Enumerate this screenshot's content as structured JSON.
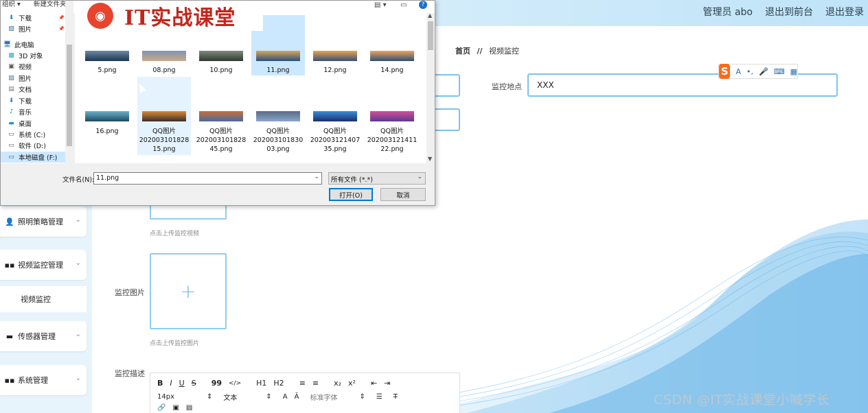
{
  "header": {
    "admin": "管理员 abo",
    "to_front": "退出到前台",
    "logout": "退出登录"
  },
  "breadcrumb": {
    "home": "首页",
    "sep": "//",
    "current": "视频监控"
  },
  "form": {
    "location_label": "监控地点",
    "location_value": "XXX",
    "video_hint": "点击上传监控视频",
    "image_label": "监控图片",
    "image_hint": "点击上传监控图片",
    "desc_label": "监控描述"
  },
  "sidebar": {
    "items": [
      {
        "label": "照明策略管理",
        "icon": "user-icon"
      },
      {
        "label": "视频监控管理",
        "icon": "grid-icon"
      },
      {
        "label": "视频监控",
        "sub": true
      },
      {
        "label": "传感器管理",
        "icon": "monitor-icon"
      },
      {
        "label": "系统管理",
        "icon": "grid-icon"
      }
    ]
  },
  "editor": {
    "toolbar1": [
      "B",
      "I",
      "U",
      "S",
      "99",
      "</>",
      "H1",
      "H2",
      "≡",
      "≡",
      "x₂",
      "x²",
      "⇤",
      "⇥"
    ],
    "font_size": "14px",
    "block_type": "文本",
    "font_family": "标准字体"
  },
  "ime": {
    "logo": "S"
  },
  "watermark": "CSDN @IT实战课堂小喊学长",
  "dialog": {
    "toolbar_left": "组织 ▾",
    "new_folder": "新建文件夹",
    "banner_text": "IT实战课堂",
    "nav": [
      {
        "label": "下载",
        "icon": "download-icon",
        "pinned": true
      },
      {
        "label": "图片",
        "icon": "picture-icon",
        "pinned": true
      },
      {
        "label": "此电脑",
        "icon": "computer-icon"
      },
      {
        "label": "3D 对象",
        "icon": "cube-icon"
      },
      {
        "label": "视频",
        "icon": "video-icon"
      },
      {
        "label": "图片",
        "icon": "picture-icon"
      },
      {
        "label": "文档",
        "icon": "document-icon"
      },
      {
        "label": "下载",
        "icon": "download-icon"
      },
      {
        "label": "音乐",
        "icon": "music-icon"
      },
      {
        "label": "桌面",
        "icon": "desktop-icon"
      },
      {
        "label": "系统 (C:)",
        "icon": "drive-icon"
      },
      {
        "label": "软件 (D:)",
        "icon": "drive-icon"
      },
      {
        "label": "本地磁盘 (F:)",
        "icon": "drive-icon"
      }
    ],
    "files": [
      {
        "name": "5.png",
        "c1": "#1d3550",
        "c2": "#6d89a6"
      },
      {
        "name": "08.png",
        "c1": "#c9a98a",
        "c2": "#7e94b3"
      },
      {
        "name": "10.png",
        "c1": "#2d3a2e",
        "c2": "#7f8c7b"
      },
      {
        "name": "11.png",
        "c1": "#2a4f7e",
        "c2": "#d7a657"
      },
      {
        "name": "12.png",
        "c1": "#384e7a",
        "c2": "#e7a64d"
      },
      {
        "name": "14.png",
        "c1": "#2c4f74",
        "c2": "#f0a35d"
      },
      {
        "name": "16.png",
        "c1": "#204a64",
        "c2": "#6ab0c8"
      },
      {
        "name": "QQ图片\n202003101828\n15.png",
        "c1": "#3b2d2a",
        "c2": "#d98a3b"
      },
      {
        "name": "QQ图片\n202003101828\n45.png",
        "c1": "#4a6aa0",
        "c2": "#c4703a"
      },
      {
        "name": "QQ图片\n202003101830\n03.png",
        "c1": "#8aa6c9",
        "c2": "#5a6a83"
      },
      {
        "name": "QQ图片\n202003121407\n35.png",
        "c1": "#1b2e6c",
        "c2": "#3c8ed8"
      },
      {
        "name": "QQ图片\n202003121411\n22.png",
        "c1": "#5a3b8c",
        "c2": "#d2509a"
      }
    ],
    "filename_label": "文件名(N):",
    "filename_value": "11.png",
    "filetype": "所有文件 (*.*)",
    "open_button": "打开(O)",
    "cancel_button": "取消"
  }
}
